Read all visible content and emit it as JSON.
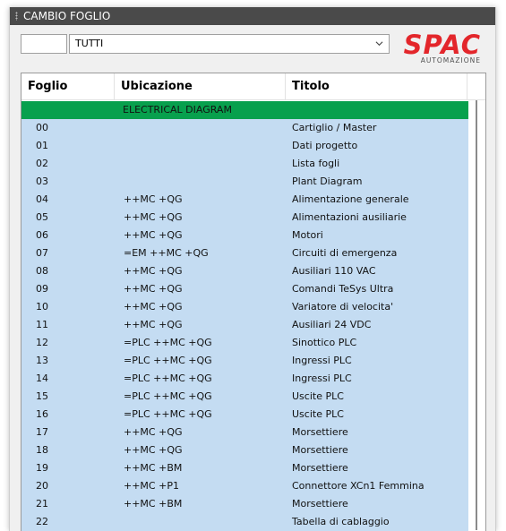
{
  "window": {
    "title": "CAMBIO FOGLIO"
  },
  "filter": {
    "sheet_number_value": "",
    "selected_option": "TUTTI"
  },
  "logo": {
    "brand": "SPAC",
    "subtitle": "AUTOMAZIONE"
  },
  "table": {
    "columns": [
      "Foglio",
      "Ubicazione",
      "Titolo"
    ],
    "group": "ELECTRICAL DIAGRAM",
    "rows": [
      {
        "foglio": "00",
        "ubicazione": "",
        "titolo": "Cartiglio / Master"
      },
      {
        "foglio": "01",
        "ubicazione": "",
        "titolo": "Dati progetto"
      },
      {
        "foglio": "02",
        "ubicazione": "",
        "titolo": "Lista fogli"
      },
      {
        "foglio": "03",
        "ubicazione": "",
        "titolo": "Plant Diagram"
      },
      {
        "foglio": "04",
        "ubicazione": "++MC +QG",
        "titolo": "Alimentazione generale"
      },
      {
        "foglio": "05",
        "ubicazione": "++MC +QG",
        "titolo": "Alimentazioni ausiliarie"
      },
      {
        "foglio": "06",
        "ubicazione": "++MC +QG",
        "titolo": "Motori"
      },
      {
        "foglio": "07",
        "ubicazione": "=EM ++MC +QG",
        "titolo": "Circuiti di emergenza"
      },
      {
        "foglio": "08",
        "ubicazione": "++MC +QG",
        "titolo": "Ausiliari 110 VAC"
      },
      {
        "foglio": "09",
        "ubicazione": "++MC +QG",
        "titolo": "Comandi TeSys Ultra"
      },
      {
        "foglio": "10",
        "ubicazione": "++MC +QG",
        "titolo": "Variatore di velocita'"
      },
      {
        "foglio": "11",
        "ubicazione": "++MC +QG",
        "titolo": "Ausiliari 24 VDC"
      },
      {
        "foglio": "12",
        "ubicazione": "=PLC ++MC +QG",
        "titolo": "Sinottico PLC"
      },
      {
        "foglio": "13",
        "ubicazione": "=PLC ++MC +QG",
        "titolo": "Ingressi PLC"
      },
      {
        "foglio": "14",
        "ubicazione": "=PLC ++MC +QG",
        "titolo": "Ingressi PLC"
      },
      {
        "foglio": "15",
        "ubicazione": "=PLC ++MC +QG",
        "titolo": "Uscite PLC"
      },
      {
        "foglio": "16",
        "ubicazione": "=PLC ++MC +QG",
        "titolo": "Uscite PLC"
      },
      {
        "foglio": "17",
        "ubicazione": "++MC +QG",
        "titolo": "Morsettiere"
      },
      {
        "foglio": "18",
        "ubicazione": "++MC +QG",
        "titolo": "Morsettiere"
      },
      {
        "foglio": "19",
        "ubicazione": "++MC +BM",
        "titolo": "Morsettiere"
      },
      {
        "foglio": "20",
        "ubicazione": "++MC +P1",
        "titolo": "Connettore  XCn1 Femmina"
      },
      {
        "foglio": "21",
        "ubicazione": "++MC +BM",
        "titolo": "Morsettiere"
      },
      {
        "foglio": "22",
        "ubicazione": "",
        "titolo": "Tabella di cablaggio"
      }
    ]
  },
  "colors": {
    "title_bar": "#4a4a4a",
    "group_row": "#07a04d",
    "row_fill": "#c4dcf2",
    "brand_red": "#e3262b"
  },
  "icons": [
    "grip-icon",
    "chevron-down-icon"
  ]
}
